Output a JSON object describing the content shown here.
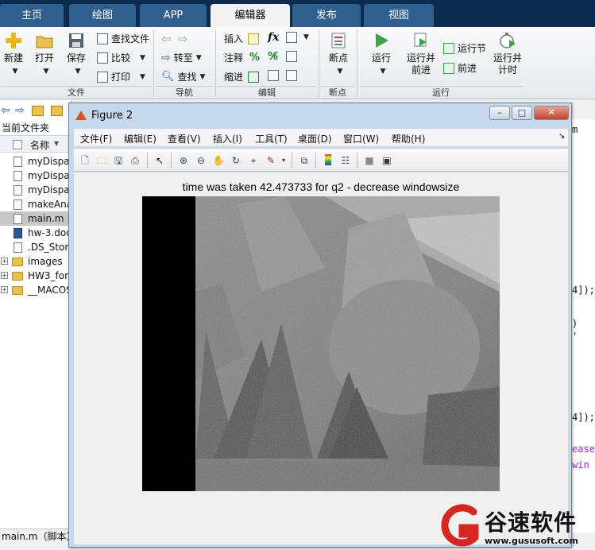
{
  "tabs": [
    {
      "label": "主页",
      "active": false
    },
    {
      "label": "绘图",
      "active": false
    },
    {
      "label": "APP",
      "active": false
    },
    {
      "label": "编辑器",
      "active": true
    },
    {
      "label": "发布",
      "active": false
    },
    {
      "label": "视图",
      "active": false
    }
  ],
  "ribbon": {
    "file": {
      "new": "新建",
      "open": "打开",
      "save": "保存",
      "find_files": "查找文件",
      "compare": "比较",
      "print": "打印",
      "section": "文件"
    },
    "navigate": {
      "goto": "转至",
      "find": "查找",
      "section": "导航"
    },
    "edit": {
      "insert": "插入",
      "comment": "注释",
      "indent": "缩进",
      "fx": "fx",
      "percent": "%",
      "section": "编辑"
    },
    "breakpoints": {
      "label": "断点",
      "section": "断点"
    },
    "run": {
      "run": "运行",
      "run_advance_1": "运行并",
      "run_advance_2": "前进",
      "run_section": "运行节",
      "advance": "前进",
      "run_time_1": "运行并",
      "run_time_2": "计时",
      "section": "运行"
    }
  },
  "left_panel": {
    "title": "当前文件夹",
    "column_header": "名称",
    "sort_indicator": "▼",
    "files": [
      {
        "name": "myDispa",
        "type": "m",
        "selected": false
      },
      {
        "name": "myDispa",
        "type": "m",
        "selected": false
      },
      {
        "name": "myDispa",
        "type": "m",
        "selected": false
      },
      {
        "name": "makeAna",
        "type": "m",
        "selected": false
      },
      {
        "name": "main.m",
        "type": "m",
        "selected": true
      },
      {
        "name": "hw-3.doc",
        "type": "doc",
        "selected": false
      },
      {
        "name": ".DS_Store",
        "type": "file",
        "selected": false
      },
      {
        "name": "images",
        "type": "folder",
        "selected": false
      },
      {
        "name": "HW3_for",
        "type": "folder",
        "selected": false
      },
      {
        "name": "__MACOS",
        "type": "folder",
        "selected": false
      }
    ],
    "status": "main.m（脚本）"
  },
  "editor_strip": {
    "lines": [
      "m",
      "4]);",
      ")",
      "'",
      "4]);",
      "ease",
      "win"
    ]
  },
  "figure": {
    "title": "Figure 2",
    "buttons": {
      "minimize": "–",
      "maximize": "□",
      "close": "✕"
    },
    "menus": [
      "文件(F)",
      "编辑(E)",
      "查看(V)",
      "插入(I)",
      "工具(T)",
      "桌面(D)",
      "窗口(W)",
      "帮助(H)"
    ],
    "menu_end_glyph": "↘",
    "plot_title": "time was taken 42.473733 for q2 - decrease windowsize"
  },
  "watermark": {
    "text": "谷速软件",
    "url": "www.gususoft.com"
  },
  "colors": {
    "tabbar": "#0d2c4d",
    "tab": "#2f5f8e",
    "run_green": "#35a845",
    "figure_frame": "#c5d8ec",
    "watermark_red": "#d7261e"
  }
}
